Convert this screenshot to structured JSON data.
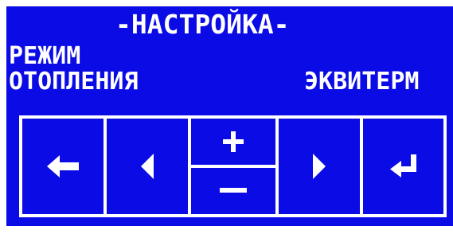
{
  "colors": {
    "screen_background": "#0b0be6",
    "foreground": "#ffffff"
  },
  "header": {
    "title": "-НАСТРОЙКА-"
  },
  "setting": {
    "label_line1": "РЕЖИМ",
    "label_line2": "ОТОПЛЕНИЯ",
    "value": "ЭКВИТЕРМ"
  },
  "keypad": {
    "keys": [
      {
        "name": "back",
        "icon": "arrow-left-icon"
      },
      {
        "name": "previous",
        "icon": "triangle-left-icon"
      },
      {
        "name": "increase",
        "icon": "plus-icon"
      },
      {
        "name": "decrease",
        "icon": "minus-icon"
      },
      {
        "name": "next",
        "icon": "triangle-right-icon"
      },
      {
        "name": "enter",
        "icon": "enter-return-icon"
      }
    ]
  }
}
